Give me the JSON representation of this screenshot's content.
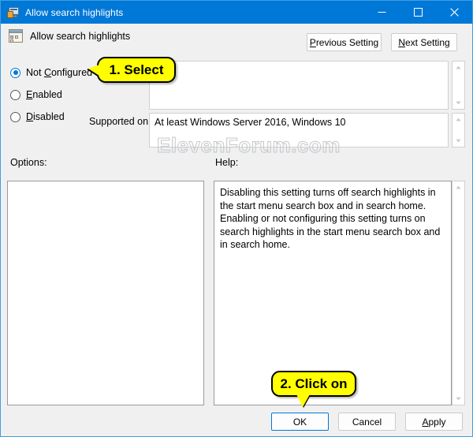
{
  "window": {
    "title": "Allow search highlights",
    "icon": "policy-setting-icon",
    "controls": {
      "minimize": "minimize-icon",
      "maximize": "maximize-icon",
      "close": "close-icon"
    }
  },
  "header": {
    "icon": "policy-setting-icon",
    "setting_name": "Allow search highlights"
  },
  "navigation": {
    "previous_label_prefix": "P",
    "previous_label_rest": "revious Setting",
    "next_label_prefix": "N",
    "next_label_rest": "ext Setting"
  },
  "state_options": [
    {
      "id": "not-configured",
      "prefix": "Not ",
      "accel": "C",
      "rest": "onfigured",
      "selected": true
    },
    {
      "id": "enabled",
      "prefix": "",
      "accel": "E",
      "rest": "nabled",
      "selected": false
    },
    {
      "id": "disabled",
      "prefix": "",
      "accel": "D",
      "rest": "isabled",
      "selected": false
    }
  ],
  "comment": {
    "value": "",
    "placeholder": ""
  },
  "supported": {
    "label": "Supported on:",
    "value": "At least Windows Server 2016, Windows 10"
  },
  "watermark": {
    "text": "ElevenForum.com"
  },
  "panels": {
    "options_label": "Options:",
    "options_content": "",
    "help_label": "Help:",
    "help_content": "Disabling this setting turns off search highlights in the start menu search box and in search home. Enabling or not configuring this setting turns on search highlights in the start menu search box and in search home."
  },
  "footer": {
    "ok_label": "OK",
    "cancel_label": "Cancel",
    "apply_accel": "A",
    "apply_rest": "pply"
  },
  "annotations": [
    {
      "id": "step-1",
      "text": "1. Select"
    },
    {
      "id": "step-2",
      "text": "2. Click on"
    }
  ],
  "colors": {
    "titlebar": "#0078d7",
    "accent": "#0078d7",
    "dialog_bg": "#f0f0f0",
    "callout_bg": "#ffff00",
    "callout_border": "#000000"
  }
}
